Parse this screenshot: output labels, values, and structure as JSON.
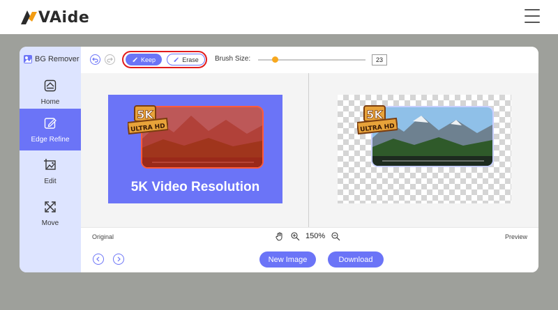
{
  "site": {
    "logo_text": "VAide"
  },
  "app": {
    "brand": "BG Remover",
    "nav": [
      {
        "label": "Home",
        "icon": "home-icon"
      },
      {
        "label": "Edge Refine",
        "icon": "edit-pen-icon"
      },
      {
        "label": "Edit",
        "icon": "crop-image-icon"
      },
      {
        "label": "Move",
        "icon": "move-arrows-icon"
      }
    ],
    "active_nav": "Edge Refine",
    "toolbar": {
      "keep_label": "Keep",
      "erase_label": "Erase",
      "brush_label": "Brush Size:",
      "brush_value": "23",
      "active_mode": "Keep"
    },
    "image": {
      "badge_top": "5K",
      "badge_bottom": "ULTRA HD",
      "caption": "5K Video Resolution"
    },
    "status": {
      "left": "Original",
      "right": "Preview",
      "zoom": "150%"
    },
    "actions": {
      "new_image": "New Image",
      "download": "Download"
    }
  },
  "colors": {
    "accent": "#6b74f7",
    "sidebar_bg": "#dde4ff",
    "highlight_border": "#e11c1c",
    "slider_thumb": "#f7a81e",
    "stage_bg": "#9ea09b"
  }
}
